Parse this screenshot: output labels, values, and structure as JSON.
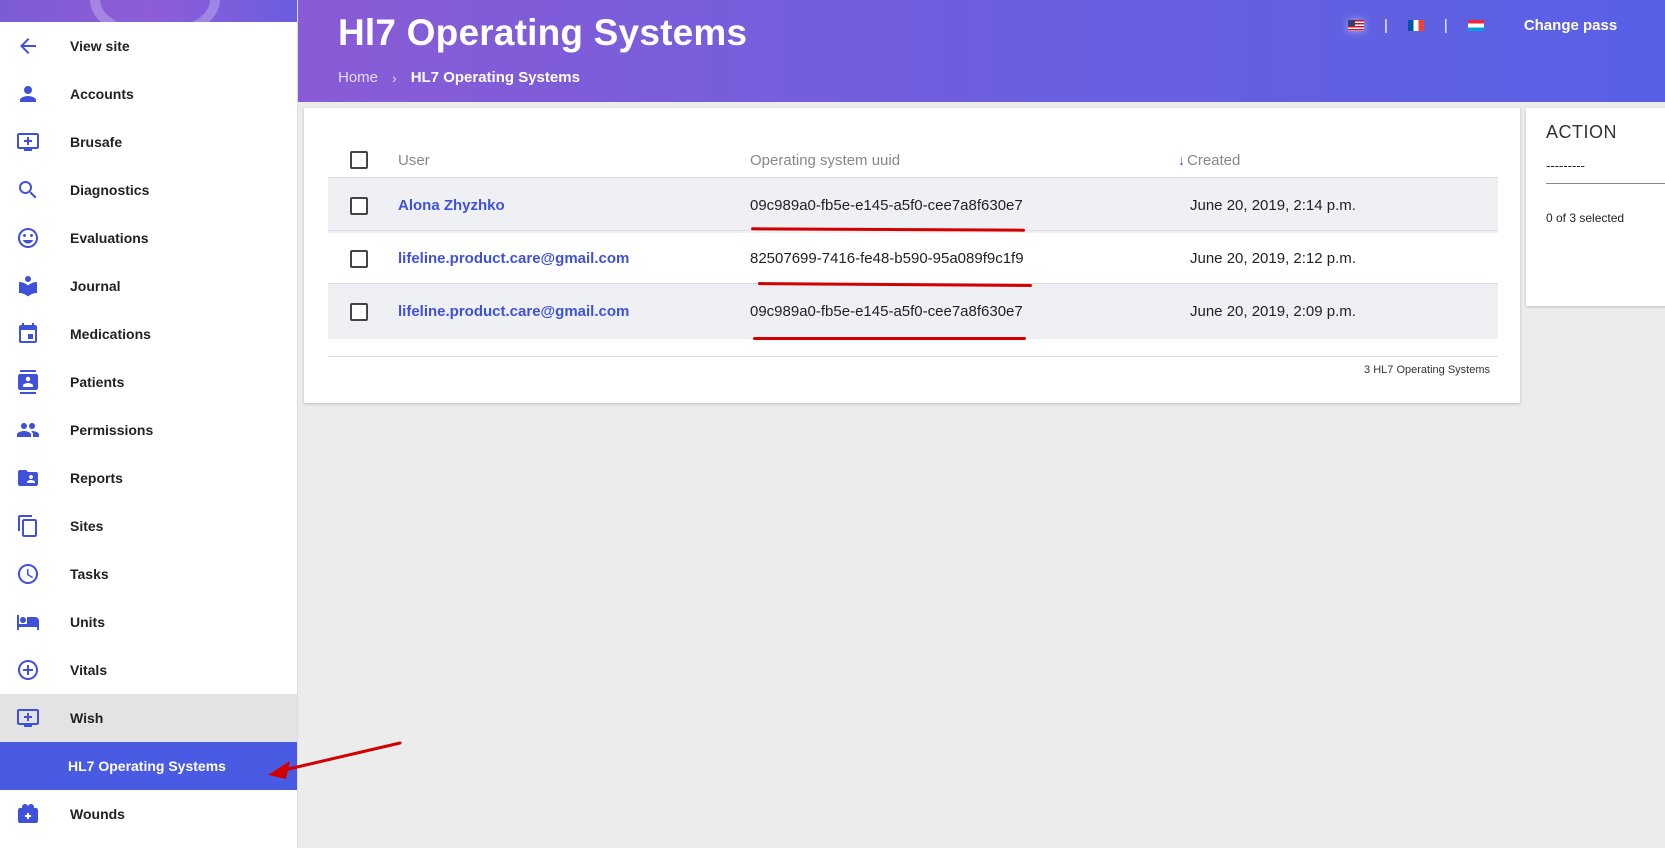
{
  "sidebar": {
    "items": [
      {
        "label": "View site",
        "icon": "arrow-back-icon"
      },
      {
        "label": "Accounts",
        "icon": "person-icon"
      },
      {
        "label": "Brusafe",
        "icon": "add-to-screen-icon"
      },
      {
        "label": "Diagnostics",
        "icon": "search-icon"
      },
      {
        "label": "Evaluations",
        "icon": "smiley-icon"
      },
      {
        "label": "Journal",
        "icon": "book-icon"
      },
      {
        "label": "Medications",
        "icon": "calendar-icon"
      },
      {
        "label": "Patients",
        "icon": "contact-card-icon"
      },
      {
        "label": "Permissions",
        "icon": "people-icon"
      },
      {
        "label": "Reports",
        "icon": "shared-folder-icon"
      },
      {
        "label": "Sites",
        "icon": "copy-icon"
      },
      {
        "label": "Tasks",
        "icon": "clock-icon"
      },
      {
        "label": "Units",
        "icon": "bed-icon"
      },
      {
        "label": "Vitals",
        "icon": "plus-circle-icon"
      },
      {
        "label": "Wish",
        "icon": "add-to-screen-icon"
      },
      {
        "label": "HL7 Operating Systems",
        "icon": ""
      },
      {
        "label": "Wounds",
        "icon": "medical-bag-icon"
      }
    ]
  },
  "header": {
    "title": "Hl7 Operating Systems",
    "breadcrumb": {
      "home": "Home",
      "separator": "›",
      "current": "HL7 Operating Systems"
    },
    "languages": [
      "en-us-flag",
      "fr-flag",
      "lu-flag"
    ],
    "separator": "|",
    "change_password": "Change pass"
  },
  "table": {
    "columns": {
      "user": "User",
      "uuid": "Operating system uuid",
      "created": "Created",
      "sort_indicator": "↓"
    },
    "rows": [
      {
        "user": "Alona Zhyzhko",
        "uuid": "09c989a0-fb5e-e145-a5f0-cee7a8f630e7",
        "created": "June 20, 2019, 2:14 p.m."
      },
      {
        "user": "lifeline.product.care@gmail.com",
        "uuid": "82507699-7416-fe48-b590-95a089f9c1f9",
        "created": "June 20, 2019, 2:12 p.m."
      },
      {
        "user": "lifeline.product.care@gmail.com",
        "uuid": "09c989a0-fb5e-e145-a5f0-cee7a8f630e7",
        "created": "June 20, 2019, 2:09 p.m."
      }
    ],
    "count": "3 HL7 Operating Systems"
  },
  "action_panel": {
    "title": "ACTION",
    "select_value": "---------",
    "selected_count": "0 of 3 selected"
  },
  "colors": {
    "accent": "#3f51d9",
    "header_gradient_start": "#8a5bd6",
    "header_gradient_end": "#5960e6",
    "annotation": "#d40000"
  }
}
